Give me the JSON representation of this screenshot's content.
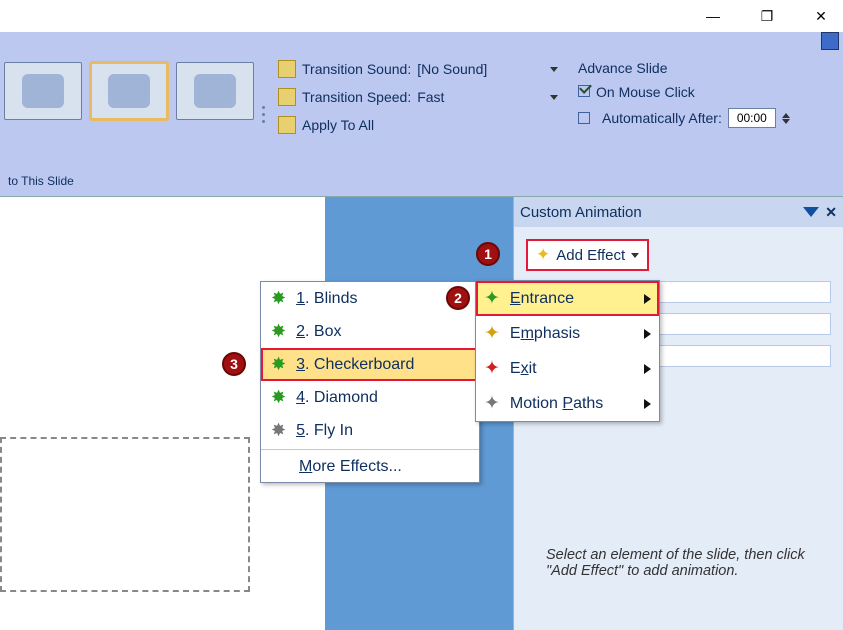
{
  "window_controls": {
    "min": "—",
    "max": "❐",
    "close": "✕"
  },
  "ribbon": {
    "transition_sound_label": "Transition Sound:",
    "transition_sound_value": "[No Sound]",
    "transition_speed_label": "Transition Speed:",
    "transition_speed_value": "Fast",
    "apply_all": "Apply To All",
    "advance_title": "Advance Slide",
    "on_click": "On Mouse Click",
    "auto_after": "Automatically After:",
    "auto_time": "00:00",
    "footer": "to This Slide"
  },
  "taskpane": {
    "title": "Custom Animation",
    "add_effect": "Add Effect",
    "hint": "Select an element of the slide, then click \"Add Effect\" to add animation."
  },
  "categories": [
    {
      "label": "Entrance",
      "letter": "E",
      "color": "c-green",
      "highlight": true
    },
    {
      "label": "Emphasis",
      "letter": "m",
      "color": "c-gold",
      "highlight": false
    },
    {
      "label": "Exit",
      "letter": "x",
      "color": "c-red",
      "highlight": false
    },
    {
      "label": "Motion Paths",
      "letter": "P",
      "color": "c-grey",
      "highlight": false
    }
  ],
  "effects": {
    "items": [
      {
        "n": "1",
        "label": "Blinds",
        "icon": "green"
      },
      {
        "n": "2",
        "label": "Box",
        "icon": "green"
      },
      {
        "n": "3",
        "label": "Checkerboard",
        "highlight": true,
        "icon": "green"
      },
      {
        "n": "4",
        "label": "Diamond",
        "icon": "green"
      },
      {
        "n": "5",
        "label": "Fly In",
        "icon": "grey"
      }
    ],
    "more": "More Effects..."
  },
  "callouts": {
    "1": "1",
    "2": "2",
    "3": "3"
  }
}
